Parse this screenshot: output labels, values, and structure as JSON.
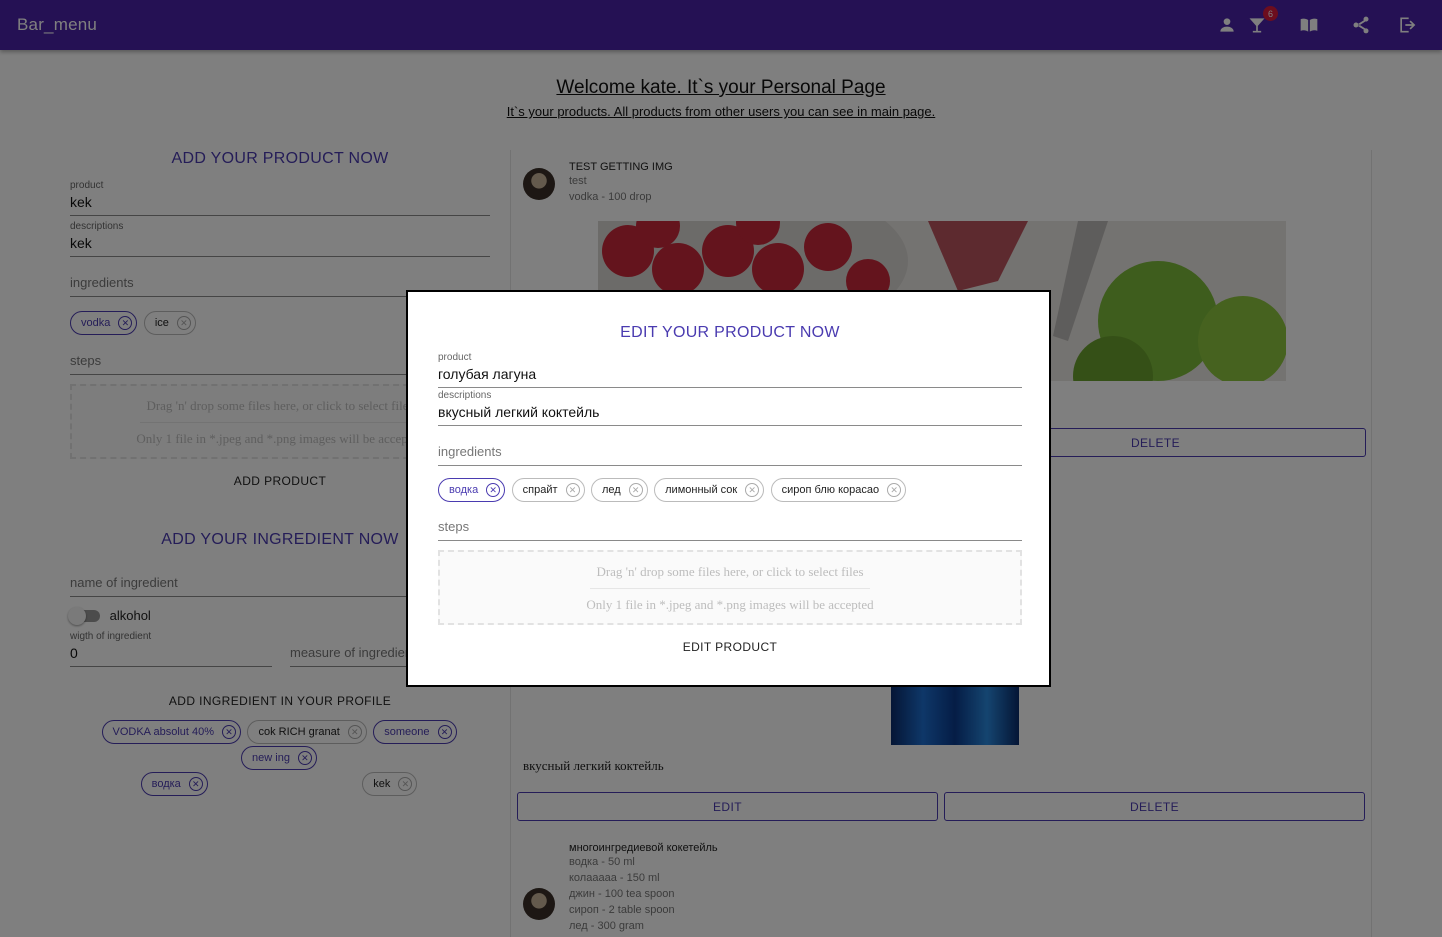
{
  "appbar": {
    "title": "Bar_menu",
    "badge_count": "6",
    "icons": [
      "person-icon",
      "cocktail-icon",
      "book-icon",
      "share-icon",
      "logout-icon"
    ],
    "color": "#4a22a8"
  },
  "header": {
    "welcome": "Welcome kate. It`s your Personal Page",
    "subtitle": "It`s your products. All products from other users you can see in main page."
  },
  "add_product": {
    "title": "ADD YOUR PRODUCT NOW",
    "product_label": "product",
    "product_value": "kek",
    "descriptions_label": "descriptions",
    "descriptions_value": "kek",
    "ingredients_placeholder": "ingredients",
    "chips": [
      {
        "label": "vodka",
        "selected": true
      },
      {
        "label": "ice",
        "selected": false
      }
    ],
    "steps_placeholder": "steps",
    "dropzone_line1": "Drag 'n' drop some files here, or click to select files",
    "dropzone_line2": "Only 1 file in *.jpeg and *.png images will be accepted",
    "button": "ADD PRODUCT"
  },
  "add_ingredient": {
    "title": "ADD YOUR INGREDIENT NOW",
    "name_placeholder": "name of ingredient",
    "alkohol_label": "alkohol",
    "weight_label": "wigth of ingredient",
    "weight_value": "0",
    "measure_placeholder": "measure of ingredient",
    "button": "ADD INGREDIENT IN YOUR PROFILE",
    "chips": [
      {
        "label": "VODKA absolut 40%",
        "selected": true
      },
      {
        "label": "cok RICH granat",
        "selected": false
      },
      {
        "label": "someone",
        "selected": true
      },
      {
        "label": "new ing",
        "selected": true
      },
      {
        "label": "водка",
        "selected": true
      },
      {
        "label": "kek",
        "selected": false
      }
    ]
  },
  "cards": [
    {
      "name": "TEST GETTING IMG",
      "lines": [
        "test",
        "vodka - 100 drop"
      ],
      "delete": "DELETE"
    },
    {
      "description": "вкусный легкий коктейль",
      "edit": "EDIT",
      "delete": "DELETE"
    },
    {
      "name": "многоингредиевой кокетейль",
      "lines": [
        "водка - 50 ml",
        "колаааaa - 150 ml",
        "джин - 100 tea spoon",
        "сироп - 2 table spoon",
        "лед - 300 gram"
      ]
    }
  ],
  "modal": {
    "title": "EDIT YOUR PRODUCT NOW",
    "product_label": "product",
    "product_value": "голубая лагуна",
    "descriptions_label": "descriptions",
    "descriptions_value": "вкусный легкий коктейль",
    "ingredients_placeholder": "ingredients",
    "chips": [
      {
        "label": "водка",
        "selected": true
      },
      {
        "label": "спрайт",
        "selected": false
      },
      {
        "label": "лед",
        "selected": false
      },
      {
        "label": "лимонный сок",
        "selected": false
      },
      {
        "label": "сироп блю корасао",
        "selected": false
      }
    ],
    "steps_placeholder": "steps",
    "dropzone_line1": "Drag 'n' drop some files here, or click to select files",
    "dropzone_line2": "Only 1 file in *.jpeg and *.png images will be accepted",
    "button": "EDIT PRODUCT"
  }
}
